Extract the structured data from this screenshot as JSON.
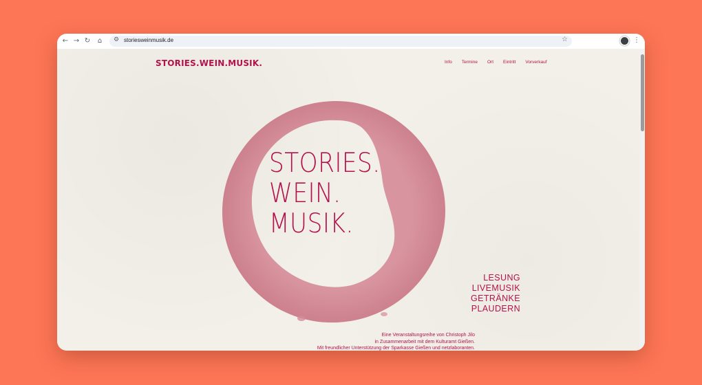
{
  "browser": {
    "url": "storiesweinmusik.de",
    "back_icon": "←",
    "forward_icon": "→",
    "reload_icon": "↻",
    "home_icon": "⌂",
    "tune_icon": "⚙",
    "star_icon": "☆",
    "menu_icon": "⋮"
  },
  "site": {
    "logo": "STORIES.WEIN.MUSIK.",
    "nav": [
      "Info",
      "Termine",
      "Ort",
      "Eintritt",
      "Vorverkauf"
    ]
  },
  "hero": {
    "title_lines": [
      "STORIES.",
      "WEIN.",
      "MUSIK."
    ],
    "features": [
      "LESUNG",
      "LIVEMUSIK",
      "GETRÄNKE",
      "PLAUDERN"
    ],
    "info_lines": [
      "Eine Veranstaltungsreihe von Christoph Jilo",
      "in Zusammenarbeit mit dem Kulturamt Gießen.",
      "Mit freundlicher Unterstützung der Sparkasse Gießen und netzlaboranten."
    ]
  },
  "colors": {
    "brand": "#b3124d",
    "stain": "#d9949f",
    "background": "#fd7656",
    "page": "#f2f0e8"
  }
}
